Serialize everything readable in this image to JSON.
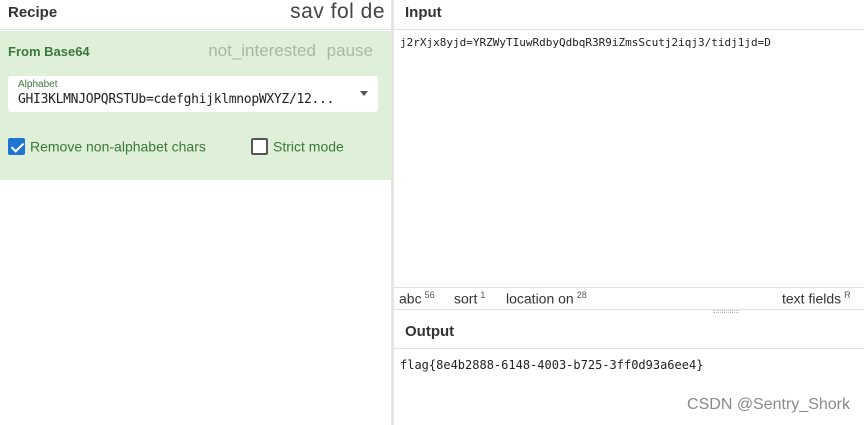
{
  "recipe": {
    "title": "Recipe",
    "header_icons": "sav fol de"
  },
  "operation": {
    "name": "From Base64",
    "disable_icon": "not_interested",
    "pause_icon": "pause",
    "alphabet": {
      "label": "Alphabet",
      "value": "GHI3KLMNJOPQRSTUb=cdefghijklmnopWXYZ/12..."
    },
    "remove_non_alphabet": {
      "label": "Remove non-alphabet chars",
      "checked": true
    },
    "strict_mode": {
      "label": "Strict mode",
      "checked": false
    }
  },
  "input": {
    "title": "Input",
    "text": "j2rXjx8yjd=YRZWyTIuwRdbyQdbqR3R9iZmsScutj2iqj3/tidj1jd=D"
  },
  "status": {
    "abc_label": "abc",
    "abc_value": "56",
    "sort_label": "sort",
    "sort_value": "1",
    "location_label": "location on",
    "location_value": "28",
    "textfields_label": "text fields",
    "textfields_value": "R"
  },
  "output": {
    "title": "Output",
    "text": "flag{8e4b2888-6148-4003-b725-3ff0d93a6ee4}"
  },
  "watermark": "CSDN @Sentry_Shork",
  "colors": {
    "operation_bg": "#dff0d8",
    "operation_text": "#3c763d",
    "checkbox_checked": "#1f73d1"
  }
}
